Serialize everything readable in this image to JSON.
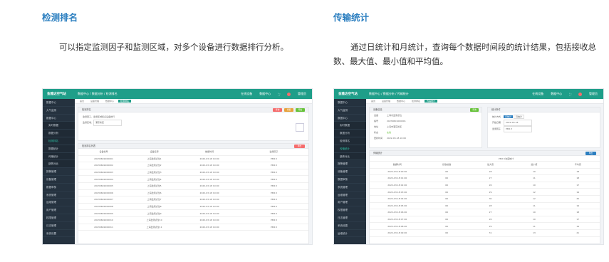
{
  "left": {
    "heading": "检测排名",
    "description": "可以指定监测因子和监测区域，对多个设备进行数据排行分析。",
    "shot": {
      "logo": "金雅达空气站",
      "breadcrumb": "数据中心 / 数据分析 / 检测排名",
      "stat1": "在线设备",
      "stat2": "数据中心",
      "user": "管理员",
      "tabs": [
        "首页",
        "设备管理",
        "数据中心",
        "检测排名"
      ],
      "filter_title": "检测排名",
      "filter_hint": "监测因子、监测区域和多设备排行",
      "filter_label": "监测区域",
      "filter_value": "浦东新区",
      "btn_query": "查询",
      "btn_reset": "重置",
      "btn_export": "导出",
      "list_title": "检测排名列表",
      "columns": [
        "设备编号",
        "设备名称",
        "数据时间",
        "监测因子"
      ],
      "rows": [
        [
          "20230601000001",
          "上海监测点位1",
          "2022-03-18 10:00",
          "PM2.5"
        ],
        [
          "20230601000002",
          "上海监测点位2",
          "2022-03-18 10:00",
          "PM2.5"
        ],
        [
          "20230601000003",
          "上海监测点位3",
          "2022-03-18 10:00",
          "PM2.5"
        ],
        [
          "20230601000004",
          "上海监测点位4",
          "2022-03-18 10:00",
          "PM2.5"
        ],
        [
          "20230601000005",
          "上海监测点位5",
          "2022-03-18 10:00",
          "PM2.5"
        ],
        [
          "20230601000006",
          "上海监测点位6",
          "2022-03-18 10:00",
          "PM2.5"
        ],
        [
          "20230601000007",
          "上海监测点位7",
          "2022-03-18 10:00",
          "PM2.5"
        ],
        [
          "20230601000008",
          "上海监测点位8",
          "2022-03-18 10:00",
          "PM2.5"
        ],
        [
          "20230601000009",
          "上海监测点位9",
          "2022-03-18 10:00",
          "PM2.5"
        ],
        [
          "20230601000010",
          "上海监测点位10",
          "2022-03-18 10:00",
          "PM2.5"
        ],
        [
          "20230601000011",
          "上海监测点位11",
          "2022-03-18 10:00",
          "PM2.5"
        ]
      ],
      "sidebar": [
        "数据中心",
        "大气监测",
        "数据中心",
        "实时数据",
        "数据分析",
        "检测排名",
        "数据统计",
        "传输统计",
        "趋势对比",
        "报警管理",
        "设备管理",
        "数据审核",
        "系统管理",
        "运维管理",
        "用户管理",
        "权限管理",
        "日志管理",
        "系统设置"
      ]
    }
  },
  "right": {
    "heading": "传输统计",
    "description": "通过日统计和月统计，查询每个数据时间段的统计结果，包括接收总数、最大值、最小值和平均值。",
    "shot": {
      "logo": "金雅达空气站",
      "breadcrumb": "数据中心 / 数据分析 / 传输统计",
      "stat1": "在线设备",
      "stat2": "数据中心",
      "user": "管理员",
      "tabs": [
        "首页",
        "设备管理",
        "数据中心",
        "检测排名",
        "传输统计"
      ],
      "info_title": "设备信息",
      "info": [
        [
          "设备",
          "上海市监测点位"
        ],
        [
          "编号",
          "20230601000001"
        ],
        [
          "地址",
          "上海市浦东新区"
        ],
        [
          "状态",
          "在线"
        ],
        [
          "更新时间",
          "2022-03-18 10:00"
        ]
      ],
      "stat_title": "统计条件",
      "stat_type_label": "统计方式",
      "stat_type_day": "日统计",
      "stat_type_month": "月统计",
      "date_label": "开始日期",
      "date_value": "2022-03-18",
      "factor_label": "监测因子",
      "factor_value": "PM2.5",
      "btn_query": "查询",
      "result_title": "传输统计",
      "btn_export": "导出",
      "group_header": "PM2.5浓度统计",
      "columns": [
        "数据时间",
        "接收总数",
        "最大值",
        "最小值",
        "平均值"
      ],
      "rows": [
        [
          "2022-03-18 00:00",
          "60",
          "28",
          "10",
          "18"
        ],
        [
          "2022-03-18 01:00",
          "60",
          "27",
          "11",
          "18"
        ],
        [
          "2022-03-18 02:00",
          "60",
          "26",
          "10",
          "17"
        ],
        [
          "2022-03-18 03:00",
          "60",
          "29",
          "12",
          "19"
        ],
        [
          "2022-03-18 04:00",
          "60",
          "30",
          "12",
          "20"
        ],
        [
          "2022-03-18 05:00",
          "60",
          "28",
          "11",
          "19"
        ],
        [
          "2022-03-18 06:00",
          "60",
          "27",
          "10",
          "18"
        ],
        [
          "2022-03-18 07:00",
          "60",
          "26",
          "10",
          "17"
        ],
        [
          "2022-03-18 08:00",
          "60",
          "29",
          "11",
          "19"
        ],
        [
          "2022-03-18 09:00",
          "60",
          "31",
          "13",
          "21"
        ]
      ],
      "sidebar": [
        "数据中心",
        "大气监测",
        "数据中心",
        "实时数据",
        "数据分析",
        "检测排名",
        "传输统计",
        "趋势对比",
        "报警管理",
        "设备管理",
        "数据审核",
        "系统管理",
        "运维管理",
        "用户管理",
        "权限管理",
        "日志管理",
        "系统设置",
        "运维统计"
      ]
    }
  },
  "colors": {
    "heading": "#2c7fc0",
    "topbar": "#1f9e89",
    "sidebar": "#25323f",
    "red": "#f56c6c",
    "green": "#67c23a",
    "orange": "#e6a23c"
  }
}
